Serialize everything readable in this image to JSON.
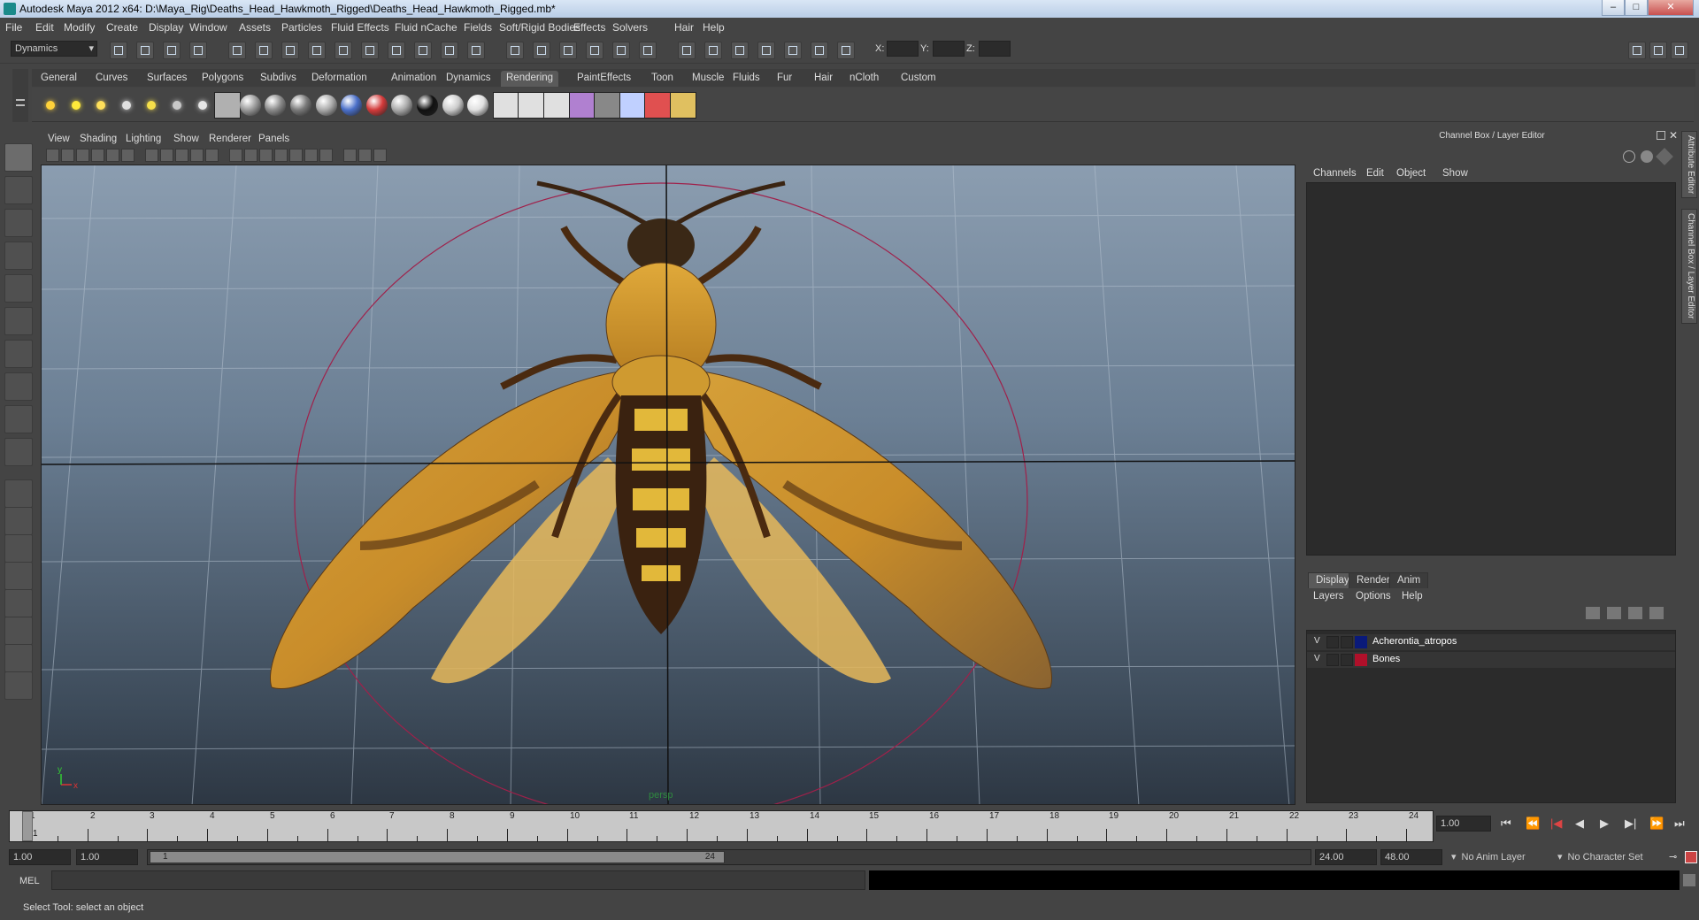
{
  "window": {
    "title": "Autodesk Maya 2012 x64: D:\\Maya_Rig\\Deaths_Head_Hawkmoth_Rigged\\Deaths_Head_Hawkmoth_Rigged.mb*",
    "min": "–",
    "max": "□",
    "close": "✕"
  },
  "menubar": [
    "File",
    "Edit",
    "Modify",
    "Create",
    "Display",
    "Window",
    "Assets",
    "Particles",
    "Fluid Effects",
    "Fluid nCache",
    "Fields",
    "Soft/Rigid Bodies",
    "Effects",
    "Solvers",
    "Hair",
    "Help"
  ],
  "statusline": {
    "mode": "Dynamics",
    "x_label": "X:",
    "y_label": "Y:",
    "z_label": "Z:"
  },
  "shelf_tabs": [
    "General",
    "Curves",
    "Surfaces",
    "Polygons",
    "Subdivs",
    "Deformation",
    "Animation",
    "Dynamics",
    "Rendering",
    "PaintEffects",
    "Toon",
    "Muscle",
    "Fluids",
    "Fur",
    "Hair",
    "nCloth",
    "Custom"
  ],
  "active_shelf_tab": "Rendering",
  "viewport": {
    "menus": [
      "View",
      "Shading",
      "Lighting",
      "Show",
      "Renderer",
      "Panels"
    ],
    "camera": "persp"
  },
  "right_panel": {
    "title": "Channel Box / Layer Editor",
    "menus": [
      "Channels",
      "Edit",
      "Object",
      "Show"
    ],
    "layer_tabs": [
      "Display",
      "Render",
      "Anim"
    ],
    "active_layer_tab": "Display",
    "layer_menus": [
      "Layers",
      "Options",
      "Help"
    ],
    "layers": [
      {
        "v": "V",
        "name": "Acherontia_atropos",
        "color": "#0a1a7a"
      },
      {
        "v": "V",
        "name": "Bones",
        "color": "#b0102a"
      }
    ],
    "side_tabs": [
      "Attribute Editor",
      "Channel Box / Layer Editor"
    ]
  },
  "timeline": {
    "ticks": [
      "1",
      "2",
      "3",
      "4",
      "5",
      "6",
      "7",
      "8",
      "9",
      "10",
      "11",
      "12",
      "13",
      "14",
      "15",
      "16",
      "17",
      "18",
      "19",
      "20",
      "21",
      "22",
      "23",
      "24"
    ],
    "current_frame": "1",
    "current_frame_field": "1.00"
  },
  "range": {
    "start": "1.00",
    "anim_start": "1.00",
    "range_start_label": "1",
    "range_end_label": "24",
    "anim_end": "24.00",
    "end": "48.00",
    "anim_layer": "No Anim Layer",
    "char_set": "No Character Set"
  },
  "cmd": {
    "label": "MEL"
  },
  "help": "Select Tool: select an object"
}
